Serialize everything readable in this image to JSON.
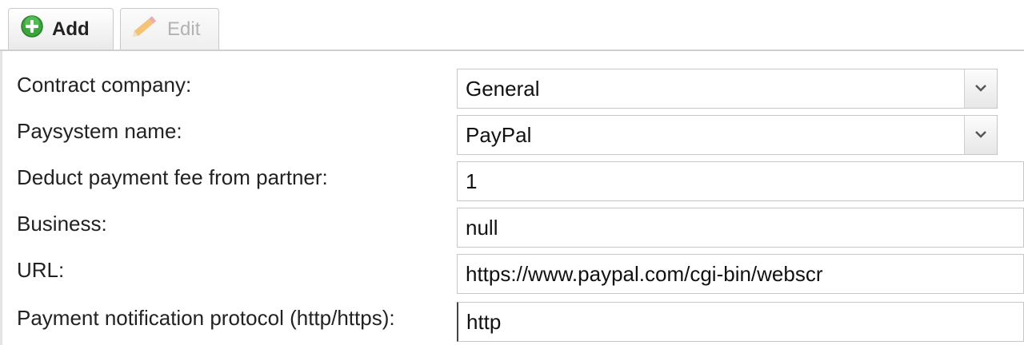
{
  "tabs": {
    "add_label": "Add",
    "edit_label": "Edit"
  },
  "icons": {
    "add": "plus-circle-icon",
    "edit": "pencil-icon",
    "dropdown": "chevron-down-icon"
  },
  "colors": {
    "add_icon_green": "#3aa63a",
    "edit_icon_orange": "#f0a030",
    "disabled_text": "#b3b3b3"
  },
  "form": {
    "contract_company": {
      "label": "Contract company:",
      "value": "General"
    },
    "paysystem_name": {
      "label": "Paysystem name:",
      "value": "PayPal"
    },
    "deduct_fee": {
      "label": "Deduct payment fee from partner:",
      "value": "1"
    },
    "business": {
      "label": "Business:",
      "value": "null"
    },
    "url": {
      "label": "URL:",
      "value": "https://www.paypal.com/cgi-bin/webscr"
    },
    "notification_protocol": {
      "label": "Payment notification protocol (http/https):",
      "value": "http"
    }
  }
}
